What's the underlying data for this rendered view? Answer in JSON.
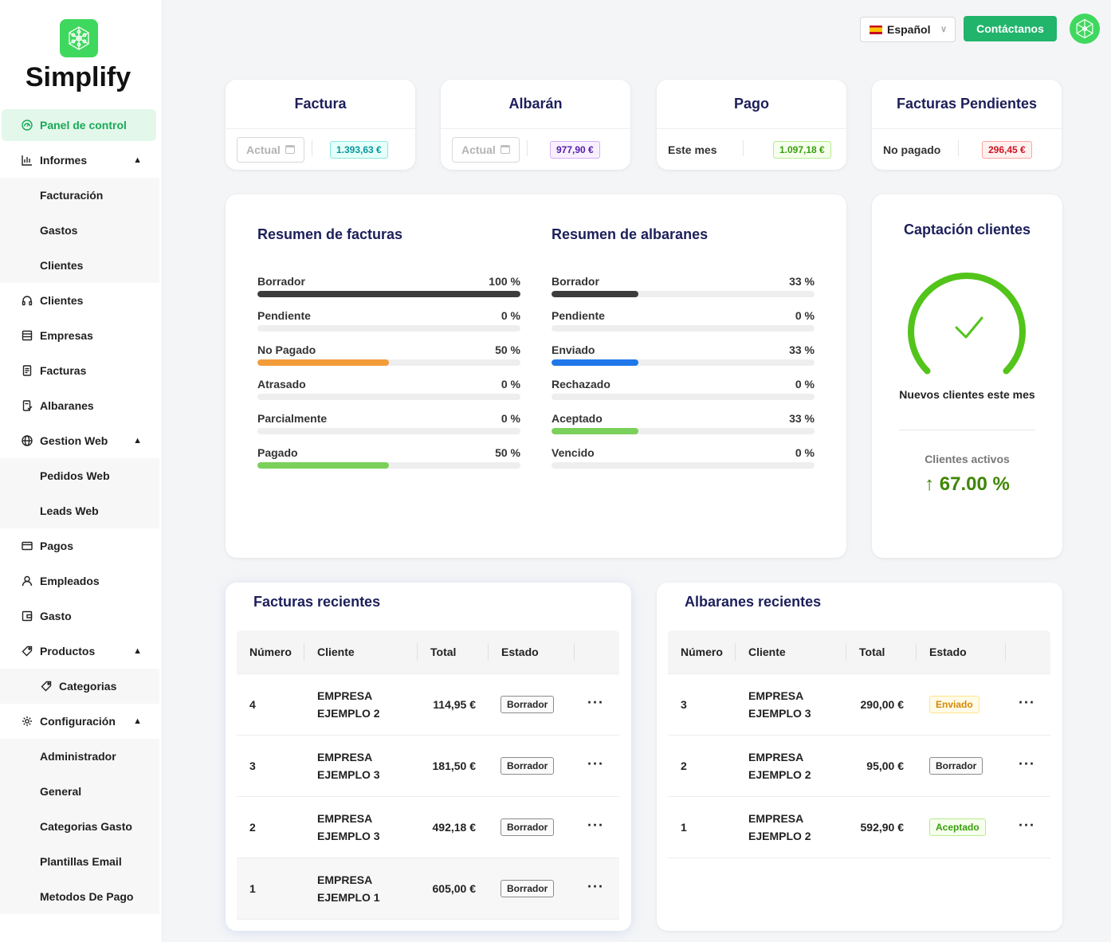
{
  "brand": {
    "name": "Simplify"
  },
  "sidebar": {
    "items": [
      {
        "label": "Panel de control",
        "icon": "dashboard-icon",
        "active": true
      },
      {
        "label": "Informes",
        "icon": "bar-chart-icon",
        "expanded": true,
        "children": [
          "Facturación",
          "Gastos",
          "Clientes"
        ]
      },
      {
        "label": "Clientes",
        "icon": "headphones-icon"
      },
      {
        "label": "Empresas",
        "icon": "shop-icon"
      },
      {
        "label": "Facturas",
        "icon": "file-text-icon"
      },
      {
        "label": "Albaranes",
        "icon": "file-done-icon"
      },
      {
        "label": "Gestion Web",
        "icon": "globe-icon",
        "expanded": true,
        "children": [
          "Pedidos Web",
          "Leads Web"
        ]
      },
      {
        "label": "Pagos",
        "icon": "credit-card-icon"
      },
      {
        "label": "Empleados",
        "icon": "user-icon"
      },
      {
        "label": "Gasto",
        "icon": "wallet-icon"
      },
      {
        "label": "Productos",
        "icon": "tag-icon",
        "expanded": true,
        "children": [
          "Categorias"
        ]
      },
      {
        "label": "Configuración",
        "icon": "settings-icon",
        "expanded": true,
        "children": [
          "Administrador",
          "General",
          "Categorias Gasto",
          "Plantillas Email",
          "Metodos De Pago"
        ]
      }
    ]
  },
  "topbar": {
    "language": "Español",
    "contact_label": "Contáctanos"
  },
  "kpis": [
    {
      "title": "Factura",
      "filter_placeholder": "Actual",
      "value": "1.393,63 €",
      "color": "#08979c"
    },
    {
      "title": "Albarán",
      "filter_placeholder": "Actual",
      "value": "977,90 €",
      "color": "#531dab"
    },
    {
      "title": "Pago",
      "period": "Este mes",
      "value": "1.097,18 €",
      "color": "#389e0d"
    },
    {
      "title": "Facturas Pendientes",
      "period": "No pagado",
      "value": "296,45 €",
      "color": "#cf1322"
    }
  ],
  "invoice_summary": {
    "title": "Resumen de facturas",
    "rows": [
      {
        "label": "Borrador",
        "percent": 100,
        "percent_text": "100 %",
        "color": "#3c3c3c"
      },
      {
        "label": "Pendiente",
        "percent": 0,
        "percent_text": "0 %",
        "color": "#cccccc"
      },
      {
        "label": "No Pagado",
        "percent": 50,
        "percent_text": "50 %",
        "color": "#f39c3a"
      },
      {
        "label": "Atrasado",
        "percent": 0,
        "percent_text": "0 %",
        "color": "#cccccc"
      },
      {
        "label": "Parcialmente",
        "percent": 0,
        "percent_text": "0 %",
        "color": "#cccccc"
      },
      {
        "label": "Pagado",
        "percent": 50,
        "percent_text": "50 %",
        "color": "#7ad05a"
      }
    ]
  },
  "delivery_summary": {
    "title": "Resumen de albaranes",
    "rows": [
      {
        "label": "Borrador",
        "percent": 33,
        "percent_text": "33 %",
        "color": "#3c3c3c"
      },
      {
        "label": "Pendiente",
        "percent": 0,
        "percent_text": "0 %",
        "color": "#cccccc"
      },
      {
        "label": "Enviado",
        "percent": 33,
        "percent_text": "33 %",
        "color": "#1f77ea"
      },
      {
        "label": "Rechazado",
        "percent": 0,
        "percent_text": "0 %",
        "color": "#cccccc"
      },
      {
        "label": "Aceptado",
        "percent": 33,
        "percent_text": "33 %",
        "color": "#7ad05a"
      },
      {
        "label": "Vencido",
        "percent": 0,
        "percent_text": "0 %",
        "color": "#cccccc"
      }
    ]
  },
  "capture": {
    "title": "Captación clientes",
    "gauge_label": "Nuevos clientes este mes",
    "active_label": "Clientes activos",
    "active_value": "67.00",
    "active_unit": "%",
    "gauge_percent": 100
  },
  "recent_invoices": {
    "title": "Facturas recientes",
    "columns": [
      "Número",
      "Cliente",
      "Total",
      "Estado"
    ],
    "rows": [
      {
        "numero": "4",
        "cliente_line1": "EMPRESA",
        "cliente_line2": "EJEMPLO 2",
        "total": "114,95 €",
        "estado": "Borrador",
        "estado_style": "b-gray"
      },
      {
        "numero": "3",
        "cliente_line1": "EMPRESA",
        "cliente_line2": "EJEMPLO 3",
        "total": "181,50 €",
        "estado": "Borrador",
        "estado_style": "b-gray"
      },
      {
        "numero": "2",
        "cliente_line1": "EMPRESA",
        "cliente_line2": "EJEMPLO 3",
        "total": "492,18 €",
        "estado": "Borrador",
        "estado_style": "b-gray"
      },
      {
        "numero": "1",
        "cliente_line1": "EMPRESA",
        "cliente_line2": "EJEMPLO 1",
        "total": "605,00 €",
        "estado": "Borrador",
        "estado_style": "b-gray"
      }
    ]
  },
  "recent_deliveries": {
    "title": "Albaranes recientes",
    "columns": [
      "Número",
      "Cliente",
      "Total",
      "Estado"
    ],
    "rows": [
      {
        "numero": "3",
        "cliente_line1": "EMPRESA",
        "cliente_line2": "EJEMPLO 3",
        "total": "290,00 €",
        "estado": "Enviado",
        "estado_style": "b-gold"
      },
      {
        "numero": "2",
        "cliente_line1": "EMPRESA",
        "cliente_line2": "EJEMPLO 2",
        "total": "95,00 €",
        "estado": "Borrador",
        "estado_style": "b-gray"
      },
      {
        "numero": "1",
        "cliente_line1": "EMPRESA",
        "cliente_line2": "EJEMPLO 2",
        "total": "592,90 €",
        "estado": "Aceptado",
        "estado_style": "b-green"
      }
    ]
  }
}
